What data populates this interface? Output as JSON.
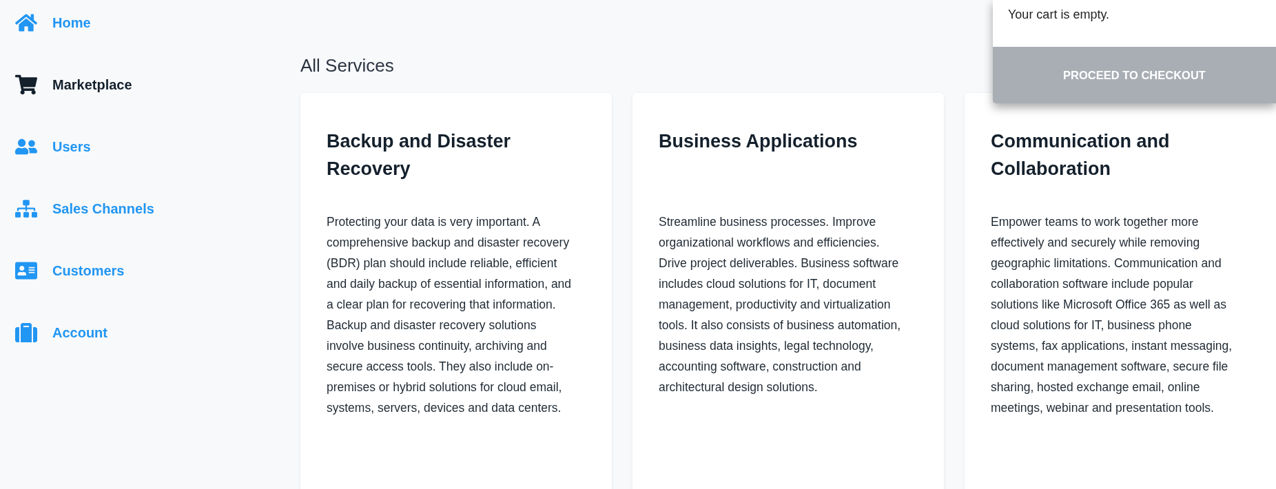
{
  "sidebar": {
    "items": [
      {
        "label": "Home",
        "selected": false
      },
      {
        "label": "Marketplace",
        "selected": true
      },
      {
        "label": "Users",
        "selected": false
      },
      {
        "label": "Sales Channels",
        "selected": false
      },
      {
        "label": "Customers",
        "selected": false
      },
      {
        "label": "Account",
        "selected": false
      }
    ]
  },
  "main": {
    "title": "All Services",
    "cards": [
      {
        "title": "Backup and Disaster Recovery",
        "text": "Protecting your data is very important. A comprehensive backup and disaster recovery (BDR) plan should include reliable, efficient and daily backup of essential information, and a clear plan for recovering that information. Backup and disaster recovery solutions involve business continuity, archiving and secure access tools. They also include on-premises or hybrid solutions for cloud email, systems, servers, devices and data centers."
      },
      {
        "title": "Business Applications",
        "text": "Streamline business processes. Improve organizational workflows and efficiencies. Drive project deliverables. Business software includes cloud solutions for IT, document management, productivity and virtualization tools. It also consists of business automation, business data insights, legal technology, accounting software, construction and architectural design solutions."
      },
      {
        "title": "Communication and Collaboration",
        "text": "Empower teams to work together more effectively and securely while removing geographic limitations. Communication and collaboration software include popular solutions like Microsoft Office 365 as well as cloud solutions for IT, business phone systems, fax applications, instant messaging, document management software, secure file sharing, hosted exchange email, online meetings, webinar and presentation tools."
      }
    ]
  },
  "cart": {
    "message": "Your cart is empty.",
    "checkout_button": {
      "label": "PROCEED TO CHECKOUT",
      "disabled": true
    }
  }
}
